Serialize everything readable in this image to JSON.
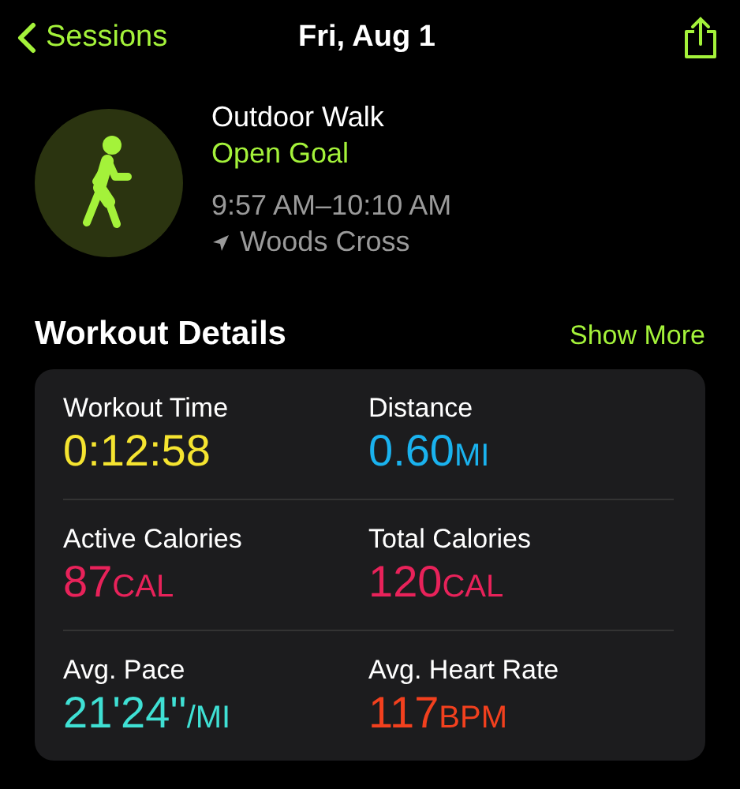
{
  "nav": {
    "back": "Sessions",
    "title": "Fri, Aug 1"
  },
  "workout": {
    "name": "Outdoor Walk",
    "goal": "Open Goal",
    "time": "9:57 AM–10:10 AM",
    "location": "Woods Cross"
  },
  "details": {
    "title": "Workout Details",
    "more": "Show More",
    "metrics": [
      {
        "label": "Workout Time",
        "value": "0:12:58",
        "color": "#f5e430"
      },
      {
        "label": "Distance",
        "value": "0.60",
        "unit": "MI",
        "color": "#1ab2ee"
      },
      {
        "label": "Active Calories",
        "value": "87",
        "unit": "CAL",
        "color": "#e8225a"
      },
      {
        "label": "Total Calories",
        "value": "120",
        "unit": "CAL",
        "color": "#e8225a"
      },
      {
        "label": "Avg. Pace",
        "value": "21'24''",
        "unit": "/MI",
        "color": "#3fe0d4"
      },
      {
        "label": "Avg. Heart Rate",
        "value": "117",
        "unit": "BPM",
        "color": "#f2401e"
      }
    ]
  }
}
